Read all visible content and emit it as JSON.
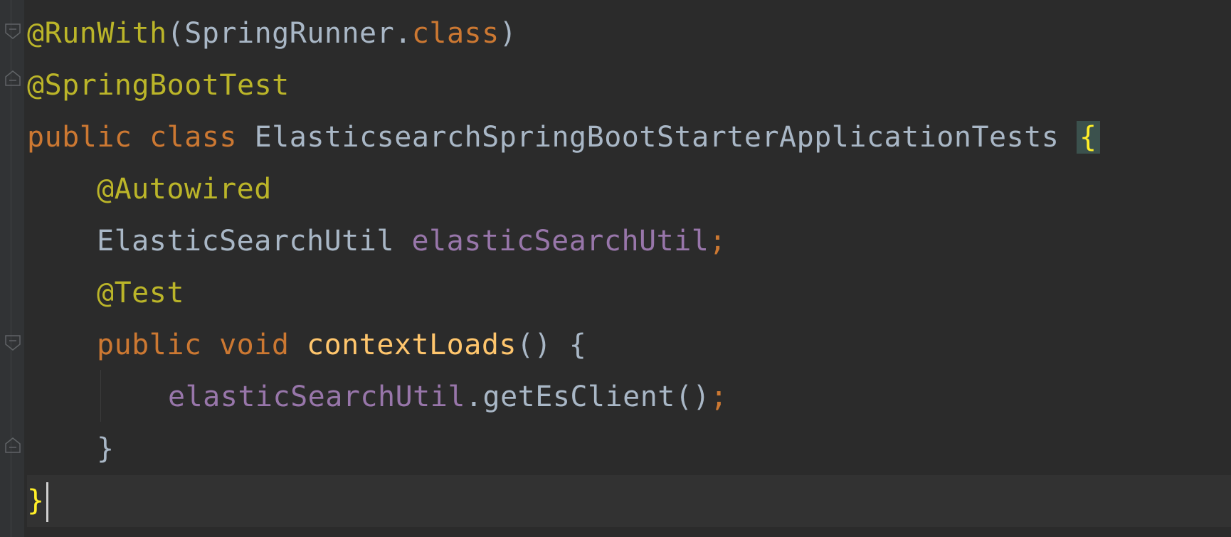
{
  "editor": {
    "lines": [
      {
        "tokens": [
          {
            "t": "@RunWith",
            "c": "anno"
          },
          {
            "t": "(SpringRunner.",
            "c": "cls"
          },
          {
            "t": "class",
            "c": "kw"
          },
          {
            "t": ")",
            "c": "punct"
          }
        ]
      },
      {
        "tokens": [
          {
            "t": "@SpringBootTest",
            "c": "anno"
          }
        ]
      },
      {
        "tokens": [
          {
            "t": "public ",
            "c": "kw"
          },
          {
            "t": "class ",
            "c": "kw"
          },
          {
            "t": "ElasticsearchSpringBootStarterApplicationTests ",
            "c": "cls"
          },
          {
            "t": "{",
            "c": "brace-hl"
          }
        ]
      },
      {
        "tokens": [
          {
            "t": "@Autowired",
            "c": "anno"
          }
        ]
      },
      {
        "tokens": [
          {
            "t": "ElasticSearchUtil ",
            "c": "cls"
          },
          {
            "t": "elasticSearchUtil",
            "c": "field"
          },
          {
            "t": ";",
            "c": "kw"
          }
        ]
      },
      {
        "tokens": [
          {
            "t": "@Test",
            "c": "anno"
          }
        ]
      },
      {
        "tokens": [
          {
            "t": "public ",
            "c": "kw"
          },
          {
            "t": "void ",
            "c": "kw"
          },
          {
            "t": "contextLoads",
            "c": "method"
          },
          {
            "t": "() {",
            "c": "punct"
          }
        ]
      },
      {
        "tokens": [
          {
            "t": "elasticSearchUtil",
            "c": "field"
          },
          {
            "t": ".getEsClient()",
            "c": "cls"
          },
          {
            "t": ";",
            "c": "kw"
          }
        ]
      },
      {
        "tokens": [
          {
            "t": "}",
            "c": "punct"
          }
        ]
      },
      {
        "tokens": [
          {
            "t": "}",
            "c": "brace-close"
          }
        ]
      }
    ]
  },
  "colors": {
    "background": "#2b2b2b",
    "annotation": "#bbb529",
    "keyword": "#cc7832",
    "field": "#9876aa",
    "method": "#ffc66d",
    "text": "#a9b7c6"
  },
  "icons": [
    "fold-open-icon",
    "fold-close-icon"
  ]
}
